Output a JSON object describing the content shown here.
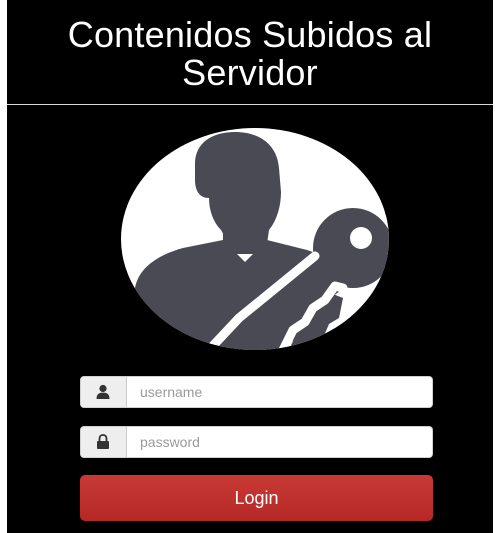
{
  "header": {
    "title": "Contenidos Subidos al Servidor"
  },
  "avatar": {
    "icon": "user-key-icon"
  },
  "login_form": {
    "username": {
      "icon": "user-icon",
      "placeholder": "username",
      "value": ""
    },
    "password": {
      "icon": "lock-icon",
      "placeholder": "password",
      "value": ""
    },
    "submit_label": "Login"
  },
  "colors": {
    "background": "#000000",
    "header_text": "#ffffff",
    "avatar_fill": "#4a4a55",
    "button": "#c13330"
  }
}
